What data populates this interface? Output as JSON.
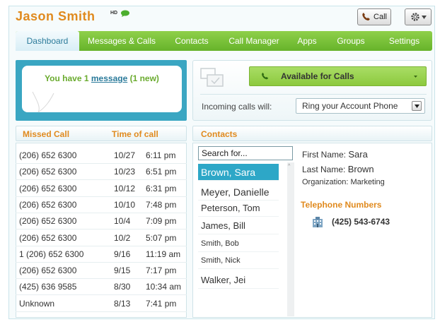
{
  "header": {
    "user_name": "Jason Smith",
    "hd_badge": "HD",
    "call_button_label": "Call",
    "gear_icon": "gear-icon",
    "phone_icon": "phone-icon",
    "chat_icon": "chat-bubble-icon"
  },
  "nav": {
    "tabs": [
      {
        "label": "Dashboard",
        "active": true
      },
      {
        "label": "Messages & Calls",
        "active": false
      },
      {
        "label": "Contacts",
        "active": false
      },
      {
        "label": "Call Manager",
        "active": false
      },
      {
        "label": "Apps",
        "active": false
      },
      {
        "label": "Groups",
        "active": false
      },
      {
        "label": "Settings",
        "active": false
      }
    ]
  },
  "messages": {
    "prefix": "You have 1 ",
    "link": "message",
    "suffix": " (1 new)"
  },
  "availability": {
    "status": "Available for Calls",
    "incoming_label": "Incoming calls will:",
    "incoming_value": "Ring your Account Phone"
  },
  "missed_calls": {
    "col_caller": "Missed Call",
    "col_time": "Time of call",
    "rows": [
      {
        "number": "(206) 652 6300",
        "date": "10/27",
        "time": "6:11 pm"
      },
      {
        "number": "(206) 652 6300",
        "date": "10/23",
        "time": "6:51 pm"
      },
      {
        "number": "(206) 652 6300",
        "date": "10/12",
        "time": "6:31 pm"
      },
      {
        "number": "(206) 652 6300",
        "date": "10/10",
        "time": "7:48 pm"
      },
      {
        "number": "(206) 652 6300",
        "date": "10/4",
        "time": "7:09 pm"
      },
      {
        "number": "(206) 652 6300",
        "date": "10/2",
        "time": "5:07 pm"
      },
      {
        "number": "1 (206) 652 6300",
        "date": "9/16",
        "time": "11:19 am"
      },
      {
        "number": "(206) 652 6300",
        "date": "9/15",
        "time": "7:17 pm"
      },
      {
        "number": "(425) 636 9585",
        "date": "8/30",
        "time": "10:34 am"
      },
      {
        "number": "Unknown",
        "date": "8/13",
        "time": "7:41 pm"
      }
    ]
  },
  "contacts": {
    "title": "Contacts",
    "search_value": "Search for...",
    "list": [
      {
        "name": "Brown, Sara",
        "selected": true,
        "size": 14
      },
      {
        "name": "Meyer,  Danielle",
        "selected": false,
        "size": 14
      },
      {
        "name": "Peterson, Tom",
        "selected": false,
        "size": 13
      },
      {
        "name": "James, Bill",
        "selected": false,
        "size": 13
      },
      {
        "name": "Smith, Bob",
        "selected": false,
        "size": 11
      },
      {
        "name": "Smith, Nick",
        "selected": false,
        "size": 11
      },
      {
        "name": "Walker, Jei",
        "selected": false,
        "size": 13
      }
    ],
    "detail": {
      "first_name_label": "First Name:",
      "first_name": "Sara",
      "last_name_label": "Last Name:",
      "last_name": "Brown",
      "org_label": "Organization:",
      "org": "Marketing",
      "phone_header": "Telephone Numbers",
      "phone": "(425) 543-6743"
    }
  },
  "colors": {
    "accent_orange": "#e08a1e",
    "nav_green": "#66b32a",
    "panel_blue": "#3aa6c2",
    "selection_blue": "#2da7c7"
  }
}
